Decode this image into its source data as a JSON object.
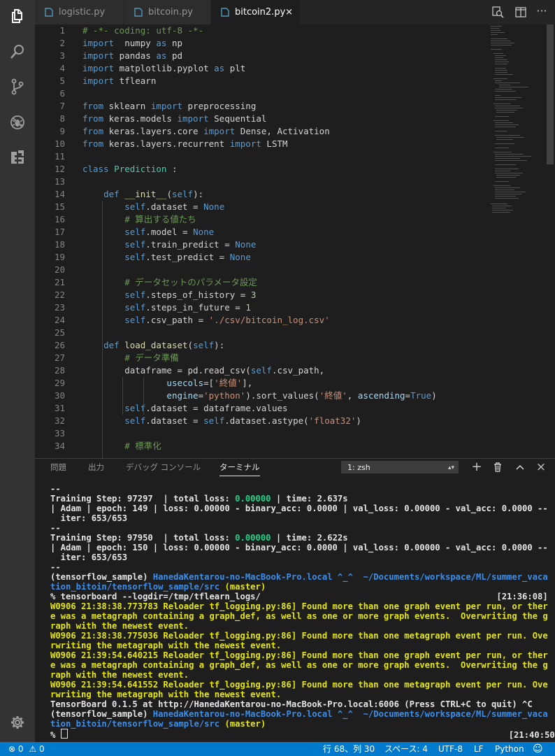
{
  "tabs": [
    {
      "label": "logistic.py",
      "active": false
    },
    {
      "label": "bitcoin.py",
      "active": false
    },
    {
      "label": "bitcoin2.py",
      "active": true
    }
  ],
  "tab_close_glyph": "×",
  "activity_icons": [
    "explorer-icon",
    "search-icon",
    "source-control-icon",
    "debug-icon",
    "extensions-icon",
    "gear-icon"
  ],
  "editor": {
    "line_numbers": [
      "1",
      "2",
      "3",
      "4",
      "5",
      "6",
      "7",
      "8",
      "9",
      "10",
      "11",
      "12",
      "13",
      "14",
      "15",
      "16",
      "17",
      "18",
      "19",
      "20",
      "21",
      "22",
      "23",
      "24",
      "25",
      "26",
      "27",
      "28",
      "29",
      "30",
      "31",
      "32",
      "33",
      "34"
    ]
  },
  "panel": {
    "tabs": [
      "問題",
      "出力",
      "デバッグ コンソール",
      "ターミナル"
    ],
    "active_tab": "ターミナル",
    "terminal_select": "1: zsh",
    "add_glyph": "+",
    "trash_glyph": "🗑",
    "maximize_glyph": "︿",
    "close_glyph": "×"
  },
  "statusbar": {
    "errors": "0",
    "warnings": "0",
    "position": "行 68、列 30",
    "spaces": "スペース: 4",
    "encoding": "UTF-8",
    "eol": "LF",
    "language": "Python",
    "feedback_icon": "smiley-icon"
  },
  "colors": {
    "status_bar": "#007acc",
    "activity_bar": "#333333",
    "editor_bg": "#1e1e1e",
    "terminal_yellow": "#e5e510",
    "terminal_green": "#23d18b",
    "terminal_blue": "#3b8eea"
  }
}
